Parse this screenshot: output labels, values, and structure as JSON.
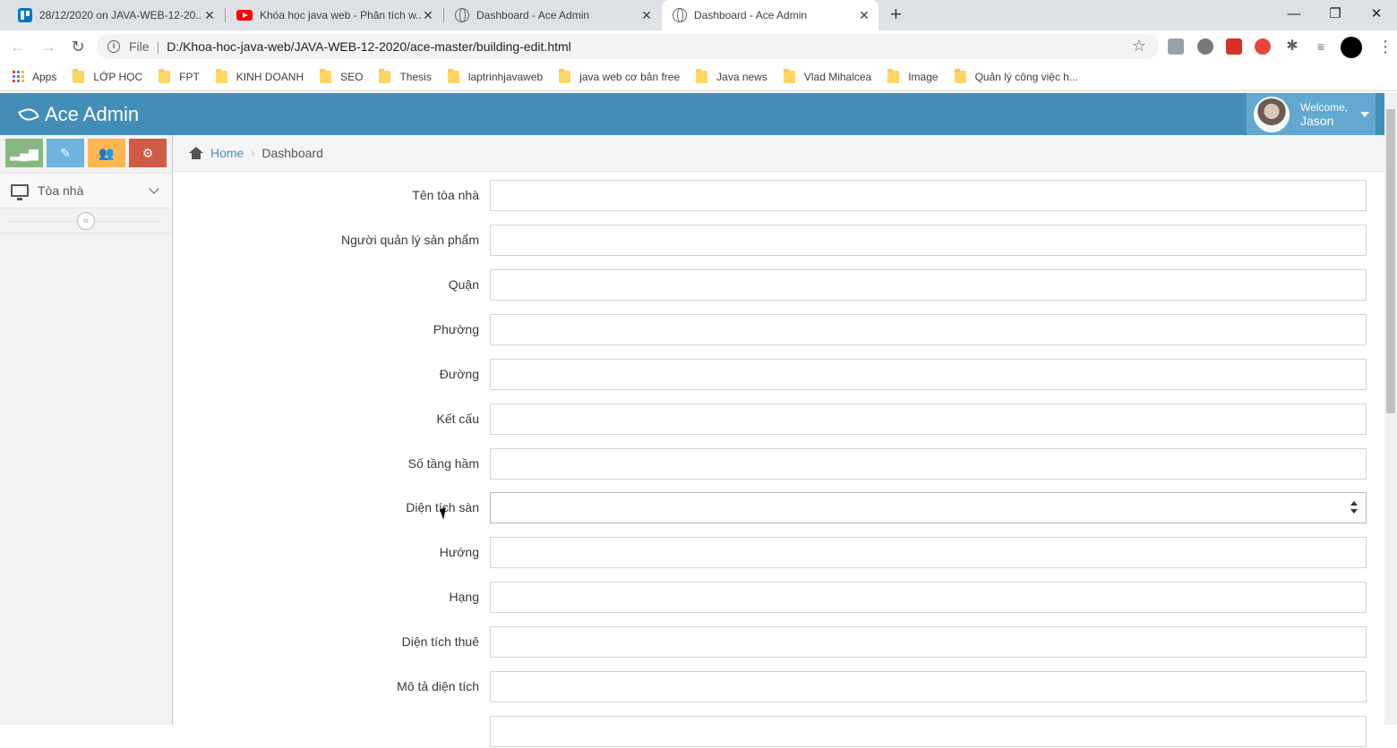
{
  "browser": {
    "tabs": [
      {
        "title": "28/12/2020 on JAVA-WEB-12-20...",
        "favicon": "trello-icon",
        "active": false
      },
      {
        "title": "Khóa học java web - Phân tích w...",
        "favicon": "youtube-icon",
        "active": false
      },
      {
        "title": "Dashboard - Ace Admin",
        "favicon": "globe-icon",
        "active": false
      },
      {
        "title": "Dashboard - Ace Admin",
        "favicon": "globe-icon",
        "active": true
      }
    ],
    "address": {
      "scheme_label": "File",
      "url": "D:/Khoa-hoc-java-web/JAVA-WEB-12-2020/ace-master/building-edit.html"
    },
    "bookmarks": [
      {
        "label": "Apps",
        "icon": "apps-grid-icon"
      },
      {
        "label": "LỚP HỌC",
        "icon": "folder-icon"
      },
      {
        "label": "FPT",
        "icon": "folder-icon"
      },
      {
        "label": "KINH DOANH",
        "icon": "folder-icon"
      },
      {
        "label": "SEO",
        "icon": "folder-icon"
      },
      {
        "label": "Thesis",
        "icon": "folder-icon"
      },
      {
        "label": "laptrinhjavaweb",
        "icon": "folder-icon"
      },
      {
        "label": "java web cơ bản free",
        "icon": "folder-icon"
      },
      {
        "label": "Java news",
        "icon": "folder-icon"
      },
      {
        "label": "Vlad Mihalcea",
        "icon": "folder-icon"
      },
      {
        "label": "Image",
        "icon": "folder-icon"
      },
      {
        "label": "Quản lý công việc h...",
        "icon": "folder-icon"
      }
    ]
  },
  "app": {
    "brand": "Ace Admin",
    "user": {
      "welcome": "Welcome,",
      "name": "Jason"
    },
    "colors": {
      "navbar": "#438eb9",
      "user_menu": "#62a8d1",
      "link": "#4c8fbd"
    }
  },
  "sidebar": {
    "shortcuts": [
      {
        "icon": "signal-icon",
        "color": "#87b87f"
      },
      {
        "icon": "pencil-icon",
        "color": "#6fb3e0"
      },
      {
        "icon": "users-icon",
        "color": "#ffb752"
      },
      {
        "icon": "cogs-icon",
        "color": "#d15b47"
      }
    ],
    "items": [
      {
        "label": "Tòa nhà",
        "icon": "desktop-icon"
      }
    ]
  },
  "breadcrumb": {
    "home": "Home",
    "current": "Dashboard"
  },
  "form": {
    "fields": [
      {
        "label": "Tên tòa nhà",
        "value": ""
      },
      {
        "label": "Người quản lý sản phẩm",
        "value": ""
      },
      {
        "label": "Quận",
        "value": ""
      },
      {
        "label": "Phường",
        "value": ""
      },
      {
        "label": "Đường",
        "value": ""
      },
      {
        "label": "Kết cấu",
        "value": ""
      },
      {
        "label": "Số tầng hầm",
        "value": ""
      },
      {
        "label": "Diện tích sàn",
        "value": "",
        "type": "number"
      },
      {
        "label": "Hướng",
        "value": ""
      },
      {
        "label": "Hạng",
        "value": ""
      },
      {
        "label": "Diện tích thuê",
        "value": ""
      },
      {
        "label": "Mô tả diện tích",
        "value": ""
      }
    ]
  }
}
